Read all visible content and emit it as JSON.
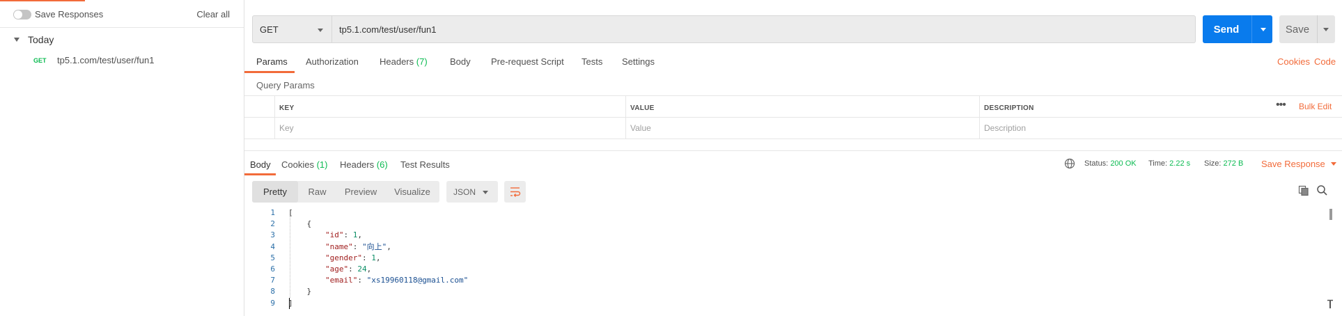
{
  "sidebar": {
    "save_responses_label": "Save Responses",
    "clear_all_label": "Clear all",
    "group_label": "Today",
    "history": [
      {
        "method": "GET",
        "url": "tp5.1.com/test/user/fun1"
      }
    ]
  },
  "request": {
    "method": "GET",
    "url": "tp5.1.com/test/user/fun1",
    "send_label": "Send",
    "save_label": "Save"
  },
  "request_tabs": {
    "params": "Params",
    "authorization": "Authorization",
    "headers": "Headers",
    "headers_count": "(7)",
    "body": "Body",
    "prerequest": "Pre-request Script",
    "tests": "Tests",
    "settings": "Settings",
    "cookies_link": "Cookies",
    "code_link": "Code"
  },
  "query_params": {
    "title": "Query Params",
    "columns": [
      "KEY",
      "VALUE",
      "DESCRIPTION"
    ],
    "placeholders": {
      "key": "Key",
      "value": "Value",
      "description": "Description"
    },
    "bulk_edit": "Bulk Edit",
    "more": "•••"
  },
  "response": {
    "tabs": {
      "body": "Body",
      "cookies": "Cookies",
      "cookies_count": "(1)",
      "headers": "Headers",
      "headers_count": "(6)",
      "test_results": "Test Results"
    },
    "status_label": "Status:",
    "status_value": "200 OK",
    "time_label": "Time:",
    "time_value": "2.22 s",
    "size_label": "Size:",
    "size_value": "272 B",
    "save_response": "Save Response",
    "views": [
      "Pretty",
      "Raw",
      "Preview",
      "Visualize"
    ],
    "active_view": "Pretty",
    "format": "JSON",
    "code_lines": [
      {
        "n": "1",
        "parts": [
          {
            "t": "[",
            "c": "p"
          }
        ]
      },
      {
        "n": "2",
        "parts": [
          {
            "t": "    {",
            "c": "p"
          }
        ]
      },
      {
        "n": "3",
        "parts": [
          {
            "t": "        ",
            "c": "p"
          },
          {
            "t": "\"id\"",
            "c": "k"
          },
          {
            "t": ": ",
            "c": "p"
          },
          {
            "t": "1",
            "c": "n"
          },
          {
            "t": ",",
            "c": "p"
          }
        ]
      },
      {
        "n": "4",
        "parts": [
          {
            "t": "        ",
            "c": "p"
          },
          {
            "t": "\"name\"",
            "c": "k"
          },
          {
            "t": ": ",
            "c": "p"
          },
          {
            "t": "\"向上\"",
            "c": "s"
          },
          {
            "t": ",",
            "c": "p"
          }
        ]
      },
      {
        "n": "5",
        "parts": [
          {
            "t": "        ",
            "c": "p"
          },
          {
            "t": "\"gender\"",
            "c": "k"
          },
          {
            "t": ": ",
            "c": "p"
          },
          {
            "t": "1",
            "c": "n"
          },
          {
            "t": ",",
            "c": "p"
          }
        ]
      },
      {
        "n": "6",
        "parts": [
          {
            "t": "        ",
            "c": "p"
          },
          {
            "t": "\"age\"",
            "c": "k"
          },
          {
            "t": ": ",
            "c": "p"
          },
          {
            "t": "24",
            "c": "n"
          },
          {
            "t": ",",
            "c": "p"
          }
        ]
      },
      {
        "n": "7",
        "parts": [
          {
            "t": "        ",
            "c": "p"
          },
          {
            "t": "\"email\"",
            "c": "k"
          },
          {
            "t": ": ",
            "c": "p"
          },
          {
            "t": "\"xs19960118@gmail.com\"",
            "c": "s"
          }
        ]
      },
      {
        "n": "8",
        "parts": [
          {
            "t": "    }",
            "c": "p"
          }
        ]
      },
      {
        "n": "9",
        "parts": [
          {
            "t": "]",
            "c": "p"
          }
        ]
      }
    ]
  },
  "colors": {
    "accent": "#f26b3a",
    "primary": "#097bed",
    "success": "#0cbb52"
  },
  "icons": {
    "toggle": "toggle-switch",
    "group_caret": "caret-down-icon",
    "more": "more-horizontal-icon",
    "globe": "globe-icon",
    "wrap": "wrap-lines-icon",
    "copy": "copy-icon",
    "search": "search-icon"
  }
}
